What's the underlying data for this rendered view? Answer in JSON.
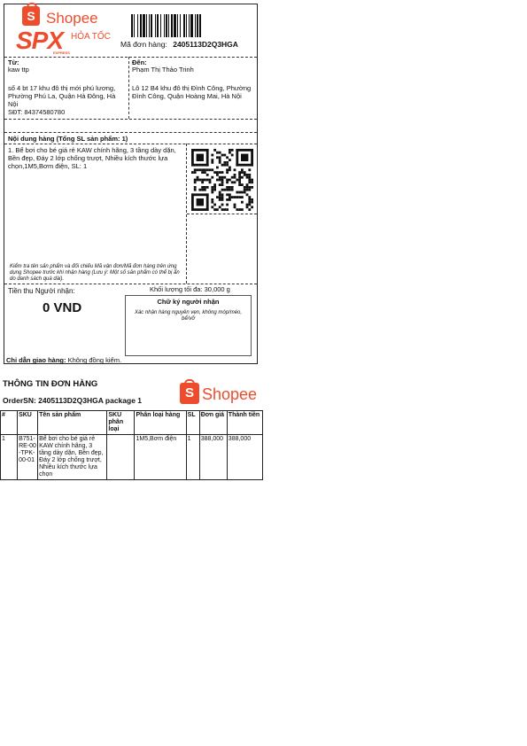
{
  "header": {
    "brand": "Shopee",
    "spx": "SPX",
    "spx_sub": "EXPRESS",
    "service": "HỎA TỐC",
    "order_label": "Mã đơn hàng:",
    "order_code": "2405113D2Q3HGA"
  },
  "sender": {
    "label": "Từ:",
    "name": "kaw ttp",
    "address": "số 4 bt 17 khu đô thị mới phú lương, Phường Phú La, Quận Hà Đông, Hà Nội",
    "phone_label": "SĐT:",
    "phone": "84374580780"
  },
  "receiver": {
    "label": "Đến:",
    "name": "Phạm Thị Thảo Trinh",
    "address": "Lô 12 B4 khu đô thị Đình Công, Phường Đình Công, Quận Hoàng Mai, Hà Nội"
  },
  "contents": {
    "title": "Nội dung hàng (Tổng SL sản phẩm: 1)",
    "item": "1. Bể bơi cho bé giá rẻ KAW chính hãng, 3 tầng dày dặn, Bền đẹp, Đáy 2 lớp chống trượt, Nhiều kích thước lựa chọn,1M5,Bơm điện, SL: 1",
    "note": "Kiểm tra tên sản phẩm và đối chiếu Mã vận đơn/Mã đơn hàng trên ứng dụng Shopee trước khi nhận hàng (Lưu ý: Một số sản phẩm có thể bị ẩn do danh sách quá dài)."
  },
  "payment": {
    "cod_label": "Tiền thu Người nhận:",
    "cod_value": "0 VND",
    "weight": "Khối lượng tối đa: 30,000 g",
    "signature_title": "Chữ ký người nhận",
    "signature_note": "Xác nhận hàng nguyên vẹn, không móp/méo, bể/vỡ"
  },
  "instruction": {
    "label": "Chỉ dẫn giao hàng:",
    "value": "Không đồng kiểm."
  },
  "order_info": {
    "title": "THÔNG TIN ĐƠN HÀNG",
    "ordersn": "OrderSN:  2405113D2Q3HGA package 1",
    "brand": "Shopee"
  },
  "table": {
    "headers": [
      "#",
      "SKU",
      "Tên sản phẩm",
      "SKU phân loại",
      "Phân loại hàng",
      "SL",
      "Đơn giá",
      "Thành tiền"
    ],
    "rows": [
      [
        "1",
        "B751-RE-00-TPK-00-01",
        "Bể bơi cho bé giá rẻ KAW chính hãng, 3 tầng dày dặn, Bền đẹp, Đáy 2 lớp chống trượt, Nhiều kích thước lựa chọn",
        "",
        "1M5,Bơm điện",
        "1",
        "388,000",
        "388,000"
      ]
    ]
  },
  "colors": {
    "brand": "#ee4d2d"
  }
}
